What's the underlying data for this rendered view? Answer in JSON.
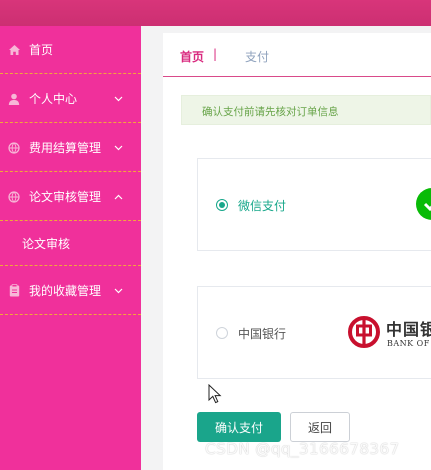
{
  "sidebar": {
    "items": [
      {
        "label": "首页",
        "icon": "home-icon"
      },
      {
        "label": "个人中心",
        "icon": "user-icon"
      },
      {
        "label": "费用结算管理",
        "icon": "globe-icon"
      },
      {
        "label": "论文审核管理",
        "icon": "globe-icon",
        "expanded": true
      },
      {
        "label": "我的收藏管理",
        "icon": "clipboard-icon"
      }
    ],
    "sub_items": [
      {
        "label": "论文审核"
      }
    ]
  },
  "breadcrumb": {
    "home": "首页",
    "separator": "|",
    "current": "支付"
  },
  "alert": {
    "text": "确认支付前请先核对订单信息"
  },
  "payment_methods": [
    {
      "label": "微信支付",
      "selected": true,
      "logo": "wechat-pay-logo"
    },
    {
      "label": "中国银行",
      "selected": false,
      "logo": "bank-of-china-logo",
      "logo_text": "中国银行",
      "logo_text_en": "BANK OF CHINA"
    }
  ],
  "buttons": {
    "confirm": "确认支付",
    "back": "返回"
  },
  "watermark": "CSDN @qq_3166678367",
  "colors": {
    "sidebar": "#f0309b",
    "topbar": "#d8357a",
    "accent_green": "#1aa58b",
    "breadcrumb_active": "#d92a7f",
    "alert_text": "#67a448",
    "bank_red": "#c8102e",
    "wechat_green": "#09bb07"
  }
}
